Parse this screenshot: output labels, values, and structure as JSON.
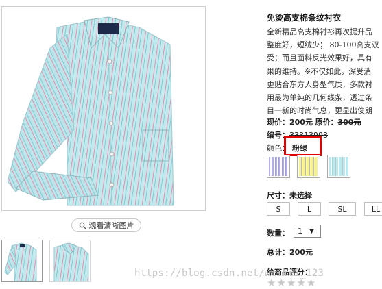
{
  "product": {
    "title": "免烫高支棉条纹衬衣",
    "description_lines": [
      "全新精品高支棉衬衫再次提升品",
      "整度好，短绒少； 80-100高支双",
      "受；而且面料反光效果好，具有",
      "果的维持。※不仅如此，深受消",
      "更贴合东方人身型气质，多款衬",
      "用最为单纯的几何线条，透过条",
      "目一新的时尚气息，更显出俊朗"
    ],
    "price_label": "现价：",
    "price_value": "200元",
    "original_label": "原价：",
    "original_value": "300元",
    "sku_label": "编号：",
    "sku_value": "33313993",
    "color_label": "颜色：",
    "color_value": "粉绿",
    "swatches": [
      {
        "name": "purple-stripe",
        "colors": [
          "#b9b6e6",
          "#ffffff"
        ]
      },
      {
        "name": "yellow-stripe",
        "colors": [
          "#f6f28a",
          "#b7b4e6"
        ]
      },
      {
        "name": "green-stripe",
        "colors": [
          "#bfe8ee",
          "#ffffff"
        ]
      }
    ],
    "size_label": "尺寸：",
    "size_value": "未选择",
    "sizes": [
      "S",
      "L",
      "SL",
      "LL"
    ],
    "quantity_label": "数量：",
    "quantity_value": "1",
    "total_label": "总计：",
    "total_value": "200元",
    "rating_label": "给商品评分："
  },
  "gallery": {
    "zoom_label": "观看清晰图片"
  },
  "watermark": "https://blog.csdn.net/weibei_123",
  "colors": {
    "highlight": "#e00000",
    "shirt": "#bfe6ea",
    "shirt_stripe": "#e98fb0"
  }
}
